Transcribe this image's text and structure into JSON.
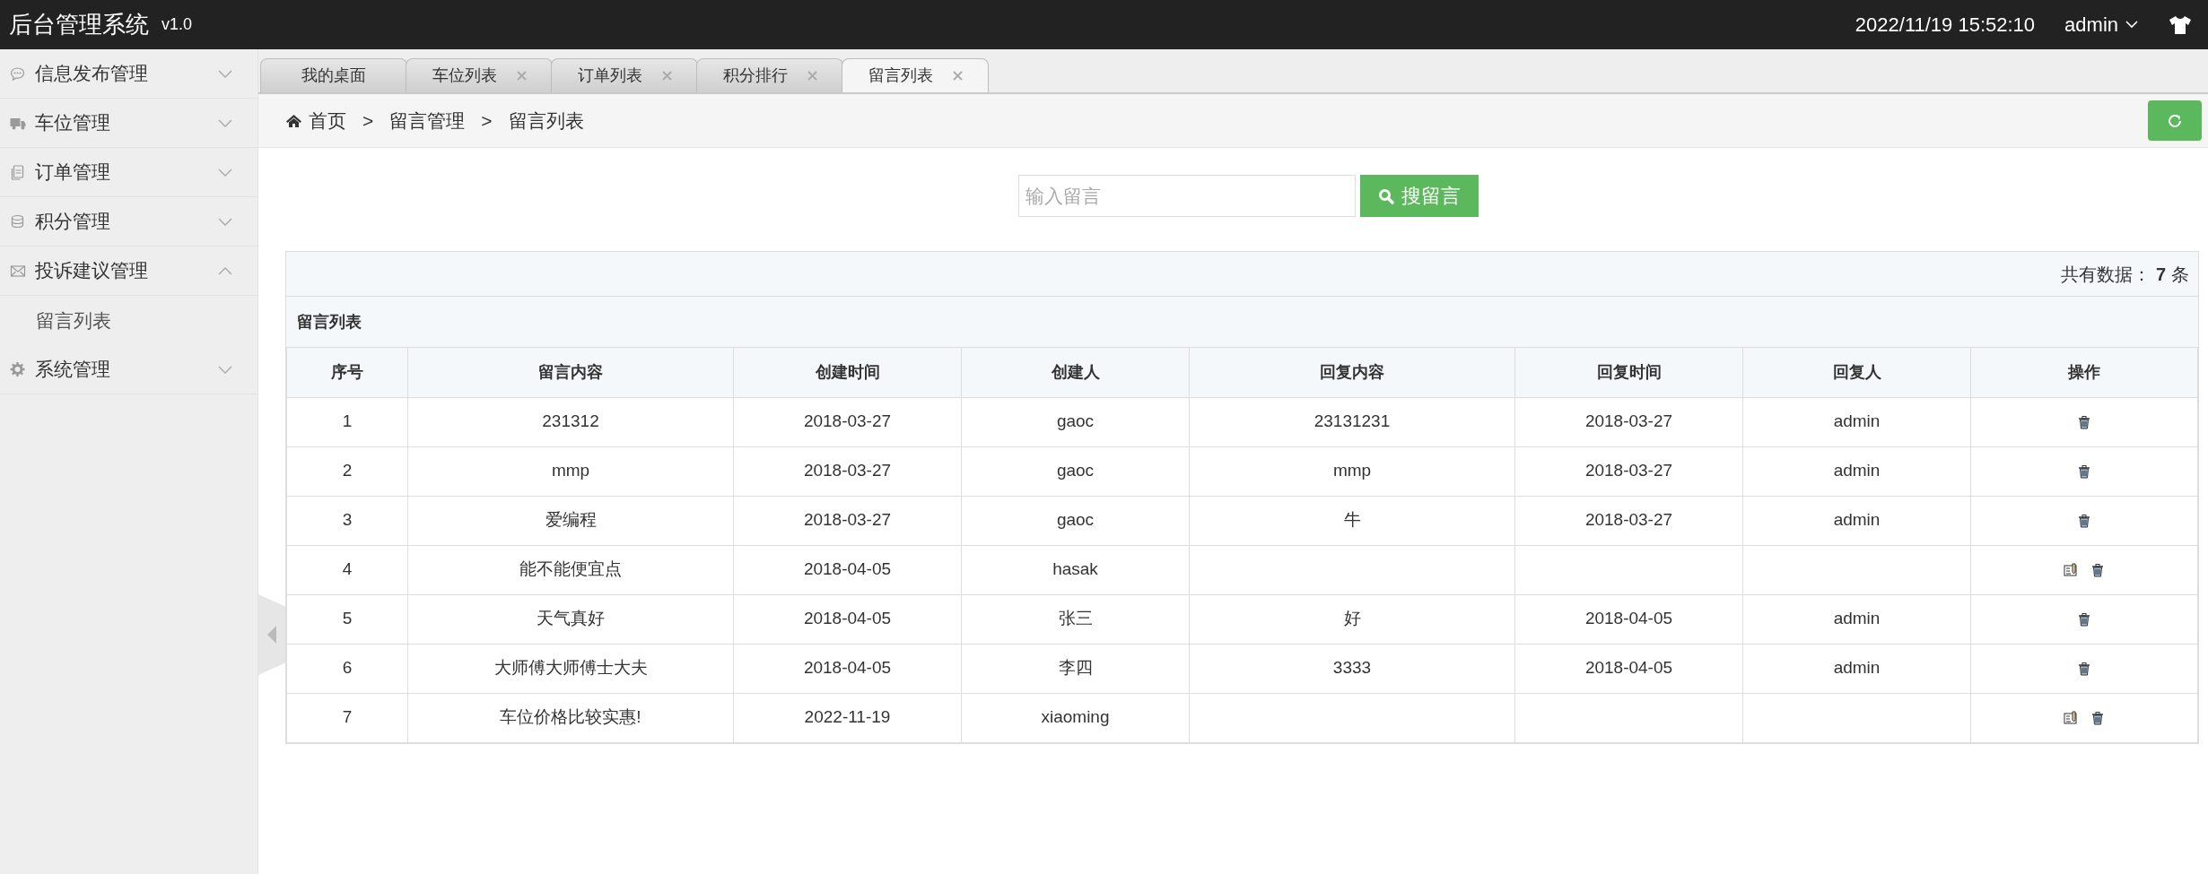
{
  "header": {
    "title": "后台管理系统",
    "version": "v1.0",
    "datetime": "2022/11/19 15:52:10",
    "user": "admin"
  },
  "sidebar": {
    "items": [
      {
        "label": "信息发布管理",
        "kind": "chat",
        "expanded": false
      },
      {
        "label": "车位管理",
        "kind": "truck",
        "expanded": false
      },
      {
        "label": "订单管理",
        "kind": "document",
        "expanded": false
      },
      {
        "label": "积分管理",
        "kind": "database",
        "expanded": false
      },
      {
        "label": "投诉建议管理",
        "kind": "envelope",
        "expanded": true,
        "children": [
          {
            "label": "留言列表"
          }
        ]
      },
      {
        "label": "系统管理",
        "kind": "gear",
        "expanded": false
      }
    ]
  },
  "tabs": [
    {
      "label": "我的桌面",
      "closable": false,
      "selected": false
    },
    {
      "label": "车位列表",
      "closable": true,
      "selected": false
    },
    {
      "label": "订单列表",
      "closable": true,
      "selected": false
    },
    {
      "label": "积分排行",
      "closable": true,
      "selected": false
    },
    {
      "label": "留言列表",
      "closable": true,
      "selected": true
    }
  ],
  "breadcrumb": [
    "首页",
    "留言管理",
    "留言列表"
  ],
  "breadcrumb_separator": ">",
  "search": {
    "placeholder": "输入留言",
    "button": "搜留言"
  },
  "summary": {
    "label": "共有数据：",
    "count": "7",
    "unit": "条"
  },
  "table": {
    "title": "留言列表",
    "columns": [
      "序号",
      "留言内容",
      "创建时间",
      "创建人",
      "回复内容",
      "回复时间",
      "回复人",
      "操作"
    ],
    "rows": [
      {
        "cells": [
          "1",
          "231312",
          "2018-03-27",
          "gaoc",
          "23131231",
          "2018-03-27",
          "admin"
        ],
        "actions": [
          {
            "kind": "delete"
          }
        ]
      },
      {
        "cells": [
          "2",
          "mmp",
          "2018-03-27",
          "gaoc",
          "mmp",
          "2018-03-27",
          "admin"
        ],
        "actions": [
          {
            "kind": "delete"
          }
        ]
      },
      {
        "cells": [
          "3",
          "爱编程",
          "2018-03-27",
          "gaoc",
          "牛",
          "2018-03-27",
          "admin"
        ],
        "actions": [
          {
            "kind": "delete"
          }
        ]
      },
      {
        "cells": [
          "4",
          "能不能便宜点",
          "2018-04-05",
          "hasak",
          "",
          "",
          ""
        ],
        "actions": [
          {
            "kind": "reply"
          },
          {
            "kind": "delete"
          }
        ]
      },
      {
        "cells": [
          "5",
          "天气真好",
          "2018-04-05",
          "张三",
          "好",
          "2018-04-05",
          "admin"
        ],
        "actions": [
          {
            "kind": "delete"
          }
        ]
      },
      {
        "cells": [
          "6",
          "大师傅大师傅士大夫",
          "2018-04-05",
          "李四",
          "3333",
          "2018-04-05",
          "admin"
        ],
        "actions": [
          {
            "kind": "delete"
          }
        ]
      },
      {
        "cells": [
          "7",
          "车位价格比较实惠!",
          "2022-11-19",
          "xiaoming",
          "",
          "",
          ""
        ],
        "actions": [
          {
            "kind": "reply"
          },
          {
            "kind": "delete"
          }
        ]
      }
    ]
  }
}
